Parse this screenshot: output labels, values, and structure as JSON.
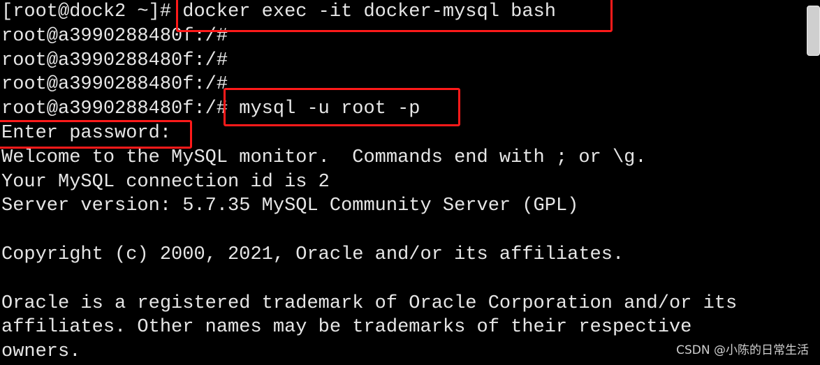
{
  "terminal": {
    "lines": [
      "[root@dock2 ~]# docker exec -it docker-mysql bash",
      "root@a3990288480f:/#",
      "root@a3990288480f:/#",
      "root@a3990288480f:/#",
      "root@a3990288480f:/# mysql -u root -p",
      "Enter password:",
      "Welcome to the MySQL monitor.  Commands end with ; or \\g.",
      "Your MySQL connection id is 2",
      "Server version: 5.7.35 MySQL Community Server (GPL)",
      "",
      "Copyright (c) 2000, 2021, Oracle and/or its affiliates.",
      "",
      "Oracle is a registered trademark of Oracle Corporation and/or its",
      "affiliates. Other names may be trademarks of their respective",
      "owners."
    ]
  },
  "colors": {
    "highlight": "#ff1a1a",
    "text": "#e6e6e6",
    "background": "#000000"
  },
  "watermark": "CSDN @小陈的日常生活"
}
